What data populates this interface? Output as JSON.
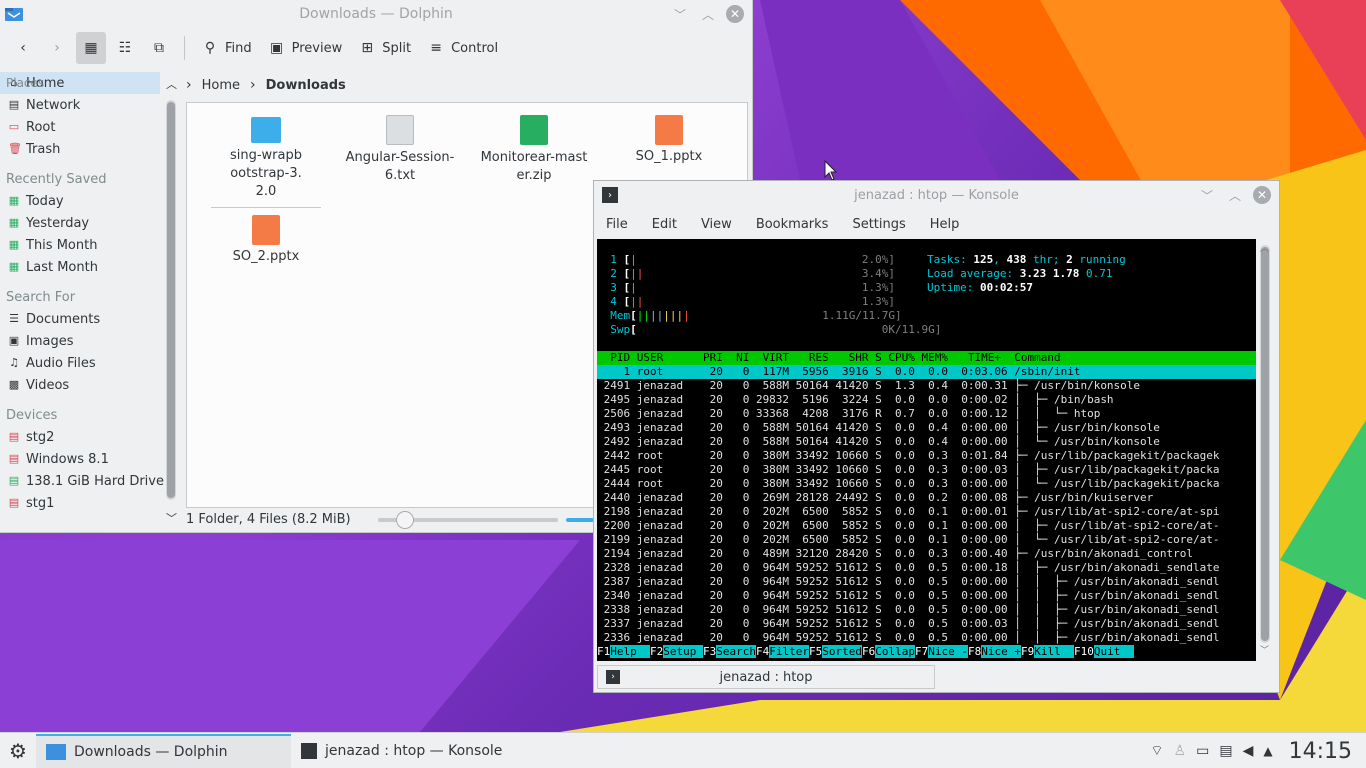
{
  "dolphin": {
    "title": "Downloads — Dolphin",
    "toolbar": {
      "find": "Find",
      "preview": "Preview",
      "split": "Split",
      "control": "Control"
    },
    "places_header": "Places",
    "places": [
      {
        "label": "Home",
        "icon": "home-icon"
      },
      {
        "label": "Network",
        "icon": "network-icon"
      },
      {
        "label": "Root",
        "icon": "folder-red-icon"
      },
      {
        "label": "Trash",
        "icon": "trash-icon"
      }
    ],
    "recent_header": "Recently Saved",
    "recent": [
      "Today",
      "Yesterday",
      "This Month",
      "Last Month"
    ],
    "search_header": "Search For",
    "search": [
      "Documents",
      "Images",
      "Audio Files",
      "Videos"
    ],
    "devices_header": "Devices",
    "devices": [
      "stg2",
      "Windows 8.1",
      "138.1 GiB Hard Drive",
      "stg1"
    ],
    "breadcrumb": {
      "home": "Home",
      "current": "Downloads"
    },
    "files": [
      {
        "name": "sing-wrapbootstrap-3.2.0",
        "type": "folder"
      },
      {
        "name": "Angular-Session-6.txt",
        "type": "text"
      },
      {
        "name": "Monitorear-master.zip",
        "type": "zip"
      },
      {
        "name": "SO_1.pptx",
        "type": "pptx"
      },
      {
        "name": "SO_2.pptx",
        "type": "pptx"
      }
    ],
    "status": "1 Folder, 4 Files (8.2 MiB)",
    "zoom_level": 0.15
  },
  "konsole": {
    "title": "jenazad : htop — Konsole",
    "menu": [
      "File",
      "Edit",
      "View",
      "Bookmarks",
      "Settings",
      "Help"
    ],
    "tab": "jenazad : htop",
    "htop": {
      "cpus": [
        {
          "n": "1",
          "pct": "2.0%]"
        },
        {
          "n": "2",
          "pct": "3.4%]"
        },
        {
          "n": "3",
          "pct": "1.3%]"
        },
        {
          "n": "4",
          "pct": "1.3%]"
        }
      ],
      "mem": "1.11G/11.7G]",
      "swp": "0K/11.9G]",
      "tasks_label": "Tasks: ",
      "tasks": "125",
      "thr": "438",
      "running": "2",
      "load_label": "Load average: ",
      "load1": "3.23",
      "load5": "1.78",
      "load15": "0.71",
      "uptime_label": "Uptime: ",
      "uptime": "00:02:57",
      "header": "  PID USER      PRI  NI  VIRT   RES   SHR S CPU% MEM%   TIME+  Command",
      "rows": [
        "    1 root       20   0  117M  5956  3916 S  0.0  0.0  0:03.06 /sbin/init",
        " 2491 jenazad    20   0  588M 50164 41420 S  1.3  0.4  0:00.31 ├─ /usr/bin/konsole",
        " 2495 jenazad    20   0 29832  5196  3224 S  0.0  0.0  0:00.02 │  ├─ /bin/bash",
        " 2506 jenazad    20   0 33368  4208  3176 R  0.7  0.0  0:00.12 │  │  └─ htop",
        " 2493 jenazad    20   0  588M 50164 41420 S  0.0  0.4  0:00.00 │  ├─ /usr/bin/konsole",
        " 2492 jenazad    20   0  588M 50164 41420 S  0.0  0.4  0:00.00 │  └─ /usr/bin/konsole",
        " 2442 root       20   0  380M 33492 10660 S  0.0  0.3  0:01.84 ├─ /usr/lib/packagekit/packagek",
        " 2445 root       20   0  380M 33492 10660 S  0.0  0.3  0:00.03 │  ├─ /usr/lib/packagekit/packa",
        " 2444 root       20   0  380M 33492 10660 S  0.0  0.3  0:00.00 │  └─ /usr/lib/packagekit/packa",
        " 2440 jenazad    20   0  269M 28128 24492 S  0.0  0.2  0:00.08 ├─ /usr/bin/kuiserver",
        " 2198 jenazad    20   0  202M  6500  5852 S  0.0  0.1  0:00.01 ├─ /usr/lib/at-spi2-core/at-spi",
        " 2200 jenazad    20   0  202M  6500  5852 S  0.0  0.1  0:00.00 │  ├─ /usr/lib/at-spi2-core/at-",
        " 2199 jenazad    20   0  202M  6500  5852 S  0.0  0.1  0:00.00 │  └─ /usr/lib/at-spi2-core/at-",
        " 2194 jenazad    20   0  489M 32120 28420 S  0.0  0.3  0:00.40 ├─ /usr/bin/akonadi_control",
        " 2328 jenazad    20   0  964M 59252 51612 S  0.0  0.5  0:00.18 │  ├─ /usr/bin/akonadi_sendlate",
        " 2387 jenazad    20   0  964M 59252 51612 S  0.0  0.5  0:00.00 │  │  ├─ /usr/bin/akonadi_sendl",
        " 2340 jenazad    20   0  964M 59252 51612 S  0.0  0.5  0:00.00 │  │  ├─ /usr/bin/akonadi_sendl",
        " 2338 jenazad    20   0  964M 59252 51612 S  0.0  0.5  0:00.00 │  │  ├─ /usr/bin/akonadi_sendl",
        " 2337 jenazad    20   0  964M 59252 51612 S  0.0  0.5  0:00.03 │  │  ├─ /usr/bin/akonadi_sendl",
        " 2336 jenazad    20   0  964M 59252 51612 S  0.0  0.5  0:00.00 │  │  ├─ /usr/bin/akonadi_sendl"
      ],
      "fkeys": [
        {
          "key": "F1",
          "label": "Help  "
        },
        {
          "key": "F2",
          "label": "Setup "
        },
        {
          "key": "F3",
          "label": "Search"
        },
        {
          "key": "F4",
          "label": "Filter"
        },
        {
          "key": "F5",
          "label": "Sorted"
        },
        {
          "key": "F6",
          "label": "Collap"
        },
        {
          "key": "F7",
          "label": "Nice -"
        },
        {
          "key": "F8",
          "label": "Nice +"
        },
        {
          "key": "F9",
          "label": "Kill  "
        },
        {
          "key": "F10",
          "label": "Quit  "
        }
      ]
    }
  },
  "taskbar": {
    "tasks": [
      {
        "label": "Downloads — Dolphin",
        "icon": "dolphin-icon"
      },
      {
        "label": "jenazad : htop — Konsole",
        "icon": "konsole-icon"
      }
    ],
    "clock": "14:15"
  },
  "colors": {
    "accent": "#3daee9",
    "selection": "#cfe3f5"
  }
}
